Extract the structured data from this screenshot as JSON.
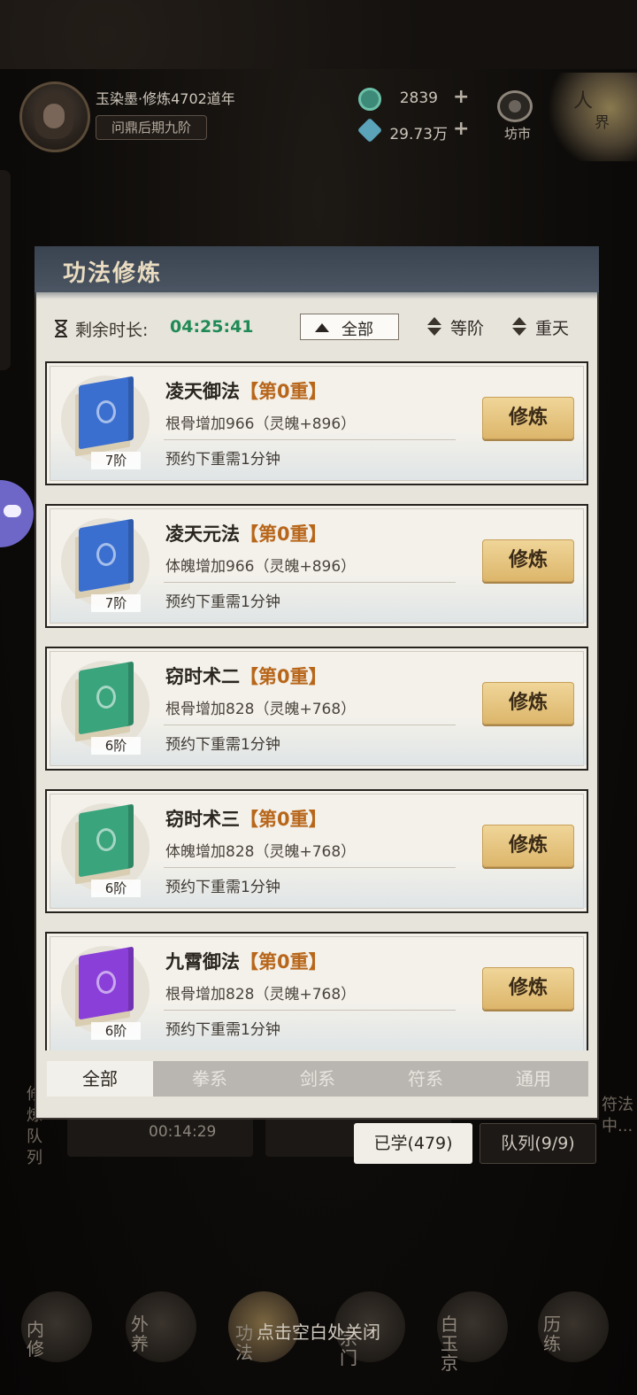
{
  "player": {
    "name": "玉染墨·修炼4702道年",
    "rank": "问鼎后期九阶"
  },
  "resources": {
    "jade_amount": "2839",
    "stone_amount": "29.73万",
    "plus": "+"
  },
  "market": {
    "label": "坊市"
  },
  "realm": {
    "char1": "人",
    "char2": "界"
  },
  "modal": {
    "title": "功法修炼",
    "remaining_label": "剩余时长:",
    "remaining_time": "04:25:41",
    "filter_all": "全部",
    "sort_grade": "等阶",
    "sort_layer": "重天"
  },
  "arts": [
    {
      "name": "凌天御法",
      "level": "【第0重】",
      "effect": "根骨增加966（灵魄+896）",
      "next": "预约下重需1分钟",
      "grade": "7阶",
      "color": "#3a6fd0",
      "icon": "blue-book-icon"
    },
    {
      "name": "凌天元法",
      "level": "【第0重】",
      "effect": "体魄增加966（灵魄+896）",
      "next": "预约下重需1分钟",
      "grade": "7阶",
      "color": "#3a6fd0",
      "icon": "blue-book-icon"
    },
    {
      "name": "窃时术二",
      "level": "【第0重】",
      "effect": "根骨增加828（灵魄+768）",
      "next": "预约下重需1分钟",
      "grade": "6阶",
      "color": "#3aa47c",
      "icon": "green-book-icon"
    },
    {
      "name": "窃时术三",
      "level": "【第0重】",
      "effect": "体魄增加828（灵魄+768）",
      "next": "预约下重需1分钟",
      "grade": "6阶",
      "color": "#3aa47c",
      "icon": "green-book-icon"
    },
    {
      "name": "九霄御法",
      "level": "【第0重】",
      "effect": "根骨增加828（灵魄+768）",
      "next": "预约下重需1分钟",
      "grade": "6阶",
      "color": "#8a3fd8",
      "icon": "purple-book-icon"
    }
  ],
  "train_label": "修炼",
  "tabs": [
    "全部",
    "拳系",
    "剑系",
    "符系",
    "通用"
  ],
  "learned": "已学(479)",
  "queue": "队列(9/9)",
  "background": {
    "timer": "00:14:29",
    "side_left": "修炼队列",
    "side_right": "符法中..."
  },
  "bottom_nav": [
    "内修",
    "外养",
    "功法",
    "宗门",
    "白玉京",
    "历练"
  ],
  "close_hint": "点击空白处关闭"
}
